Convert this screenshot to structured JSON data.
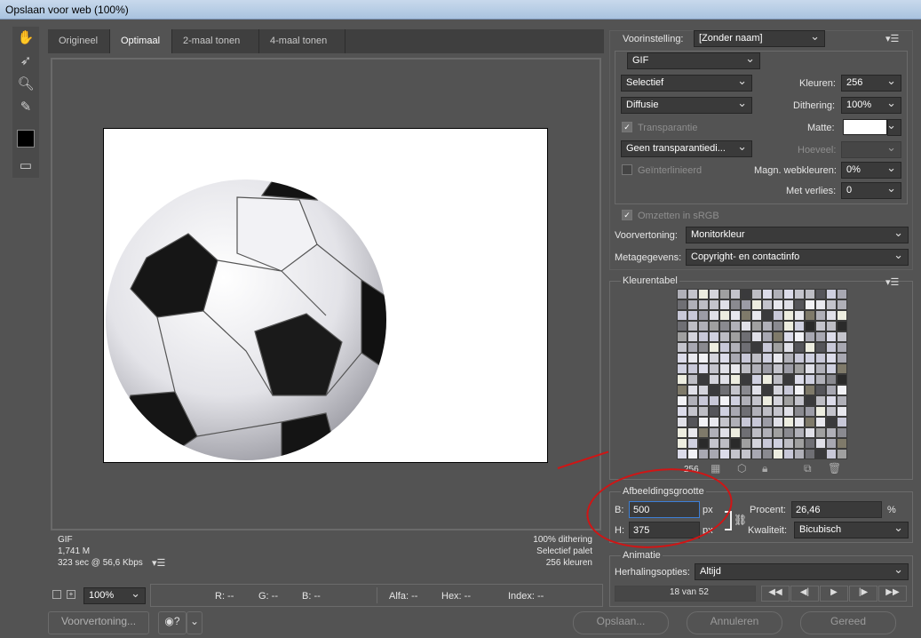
{
  "window": {
    "title": "Opslaan voor web (100%)"
  },
  "tabs": [
    {
      "label": "Origineel"
    },
    {
      "label": "Optimaal"
    },
    {
      "label": "2-maal tonen"
    },
    {
      "label": "4-maal tonen"
    }
  ],
  "info_left": {
    "format": "GIF",
    "size": "1,741 M",
    "time": "323 sec @ 56,6 Kbps"
  },
  "info_right": {
    "dithering": "100% dithering",
    "palette": "Selectief palet",
    "colors": "256 kleuren"
  },
  "status": {
    "zoom": "100%",
    "r": "R: --",
    "g": "G: --",
    "b": "B: --",
    "alpha": "Alfa: --",
    "hex": "Hex: --",
    "index": "Index: --"
  },
  "bottom_buttons": {
    "preview": "Voorvertoning...",
    "save": "Opslaan...",
    "cancel": "Annuleren",
    "done": "Gereed"
  },
  "settings": {
    "preset_label": "Voorinstelling:",
    "preset_value": "[Zonder naam]",
    "format": "GIF",
    "reduction": "Selectief",
    "colors_label": "Kleuren:",
    "colors_value": "256",
    "dither_method": "Diffusie",
    "dithering_label": "Dithering:",
    "dithering_value": "100%",
    "transparency_label": "Transparantie",
    "matte_label": "Matte:",
    "trans_dither": "Geen transparantiedi...",
    "amount_label": "Hoeveel:",
    "interlaced_label": "Geïnterlinieerd",
    "web_snap_label": "Magn. webkleuren:",
    "web_snap_value": "0%",
    "lossy_label": "Met verlies:",
    "lossy_value": "0",
    "srgb_label": "Omzetten in sRGB",
    "preview_label": "Voorvertoning:",
    "preview_value": "Monitorkleur",
    "metadata_label": "Metagegevens:",
    "metadata_value": "Copyright- en contactinfo"
  },
  "color_table": {
    "title": "Kleurentabel",
    "count": "256"
  },
  "image_size": {
    "title": "Afbeeldingsgrootte",
    "w_label": "B:",
    "w_value": "500",
    "w_unit": "px",
    "h_label": "H:",
    "h_value": "375",
    "h_unit": "px",
    "percent_label": "Procent:",
    "percent_value": "26,46",
    "percent_unit": "%",
    "quality_label": "Kwaliteit:",
    "quality_value": "Bicubisch"
  },
  "animation": {
    "title": "Animatie",
    "loop_label": "Herhalingsopties:",
    "loop_value": "Altijd",
    "frame_counter": "18 van 52"
  },
  "colors": {
    "annotation_red": "#d01515"
  }
}
